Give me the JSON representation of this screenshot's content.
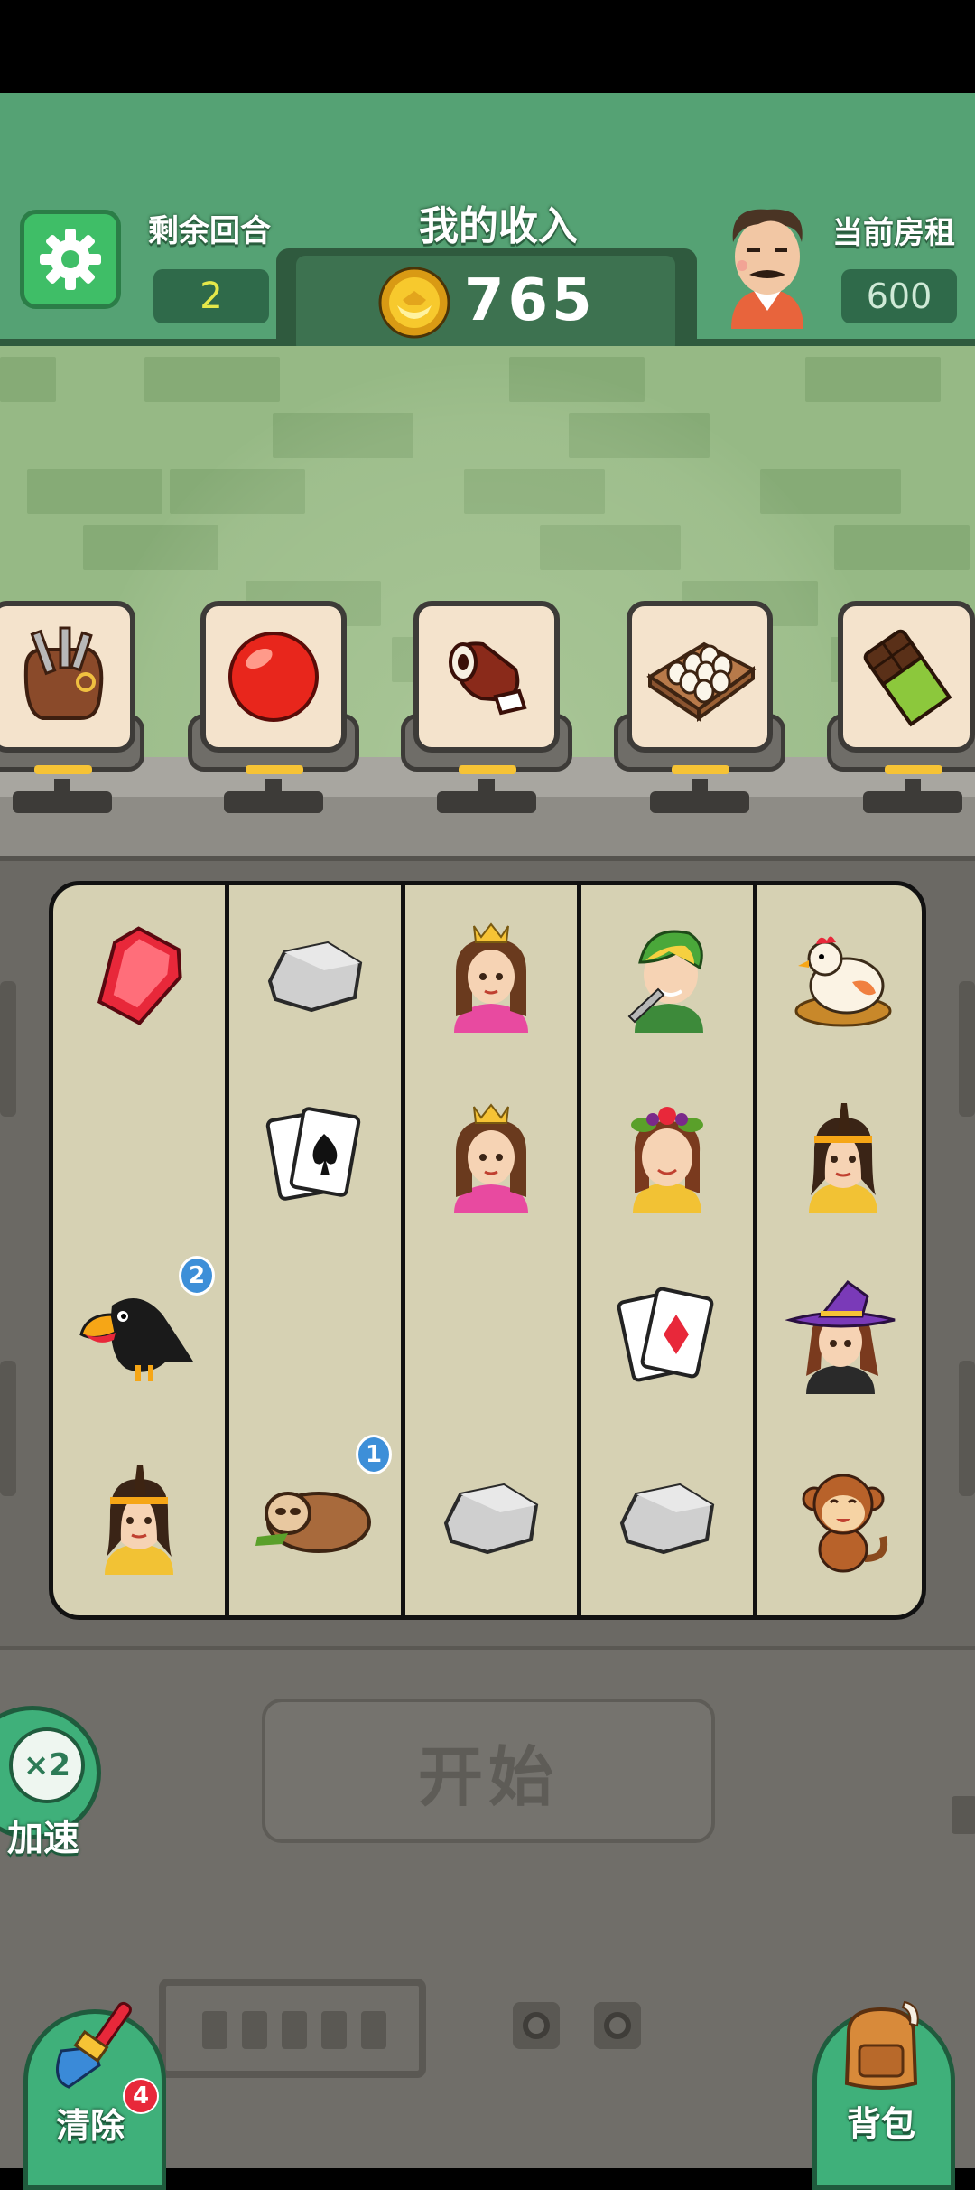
{
  "header": {
    "remaining_rounds_label": "剩余回合",
    "remaining_rounds_value": "2",
    "income_title": "我的收入",
    "income_value": "765",
    "rent_label": "当前房租",
    "rent_value": "600"
  },
  "shelf_items": [
    {
      "icon": "tool-bag-icon"
    },
    {
      "icon": "red-ball-icon"
    },
    {
      "icon": "meat-icon"
    },
    {
      "icon": "egg-tray-icon"
    },
    {
      "icon": "chocolate-icon"
    }
  ],
  "board": {
    "columns": [
      [
        "ruby-icon",
        "empty",
        "toucan-icon",
        "tribal-girl-icon"
      ],
      [
        "rock-icon",
        "spade-cards-icon",
        "empty",
        "sloth-icon"
      ],
      [
        "princess-icon",
        "princess-icon",
        "empty",
        "rock-icon"
      ],
      [
        "elf-warrior-icon",
        "fruit-girl-icon",
        "diamond-cards-icon",
        "rock-icon"
      ],
      [
        "hen-icon",
        "tribal-girl-icon",
        "witch-icon",
        "monkey-icon"
      ]
    ],
    "badges": {
      "toucan": "2",
      "sloth": "1"
    }
  },
  "controls": {
    "start_label": "开始",
    "speed_icon_text": "×2",
    "speed_label": "加速",
    "clear_label": "清除",
    "clear_badge": "4",
    "bag_label": "背包"
  },
  "colors": {
    "top_bar": "#55a274",
    "wall": "#96b985",
    "board": "#d6d1b3",
    "accent_green": "#3fb07a",
    "gold": "#f6c335"
  }
}
